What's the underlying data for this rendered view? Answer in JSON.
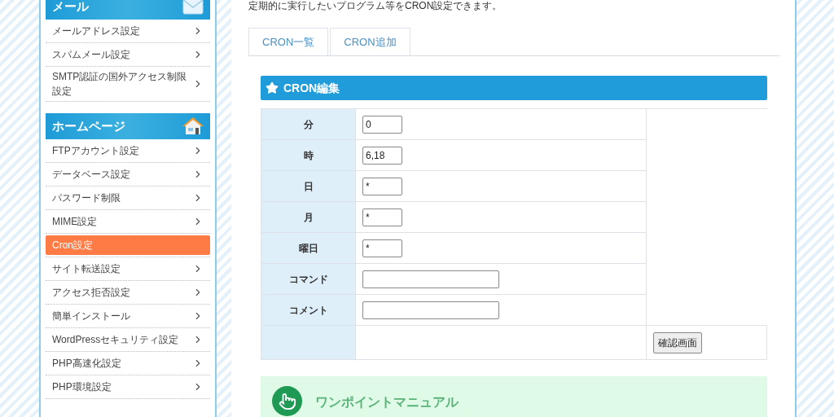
{
  "sidebar": {
    "sections": [
      {
        "title": "メール",
        "kind": "mail",
        "items": [
          {
            "label": "メールアドレス設定",
            "selected": false
          },
          {
            "label": "スパムメール設定",
            "selected": false
          },
          {
            "label": "SMTP認証の国外アクセス制限設定",
            "selected": false
          }
        ]
      },
      {
        "title": "ホームページ",
        "kind": "home",
        "items": [
          {
            "label": "FTPアカウント設定",
            "selected": false
          },
          {
            "label": "データベース設定",
            "selected": false
          },
          {
            "label": "パスワード制限",
            "selected": false
          },
          {
            "label": "MIME設定",
            "selected": false
          },
          {
            "label": "Cron設定",
            "selected": true
          },
          {
            "label": "サイト転送設定",
            "selected": false
          },
          {
            "label": "アクセス拒否設定",
            "selected": false
          },
          {
            "label": "簡単インストール",
            "selected": false
          },
          {
            "label": "WordPressセキュリティ設定",
            "selected": false
          },
          {
            "label": "PHP高速化設定",
            "selected": false
          },
          {
            "label": "PHP環境設定",
            "selected": false
          }
        ]
      }
    ]
  },
  "main": {
    "intro": "定期的に実行したいプログラム等をCRON設定できます。",
    "tabs": [
      {
        "label": "CRON一覧",
        "selected": false
      },
      {
        "label": "CRON追加",
        "selected": false
      }
    ],
    "form": {
      "title": "CRON編集",
      "fields": [
        {
          "label": "分",
          "value": "0",
          "kind": "short"
        },
        {
          "label": "時",
          "value": "6,18",
          "kind": "short"
        },
        {
          "label": "日",
          "value": "*",
          "kind": "short"
        },
        {
          "label": "月",
          "value": "*",
          "kind": "short"
        },
        {
          "label": "曜日",
          "value": "*",
          "kind": "short"
        },
        {
          "label": "コマンド",
          "kind": "long"
        },
        {
          "label": "コメント",
          "kind": "long"
        }
      ],
      "button": "確認画面"
    },
    "manual": {
      "title": "ワンポイントマニュアル"
    }
  }
}
